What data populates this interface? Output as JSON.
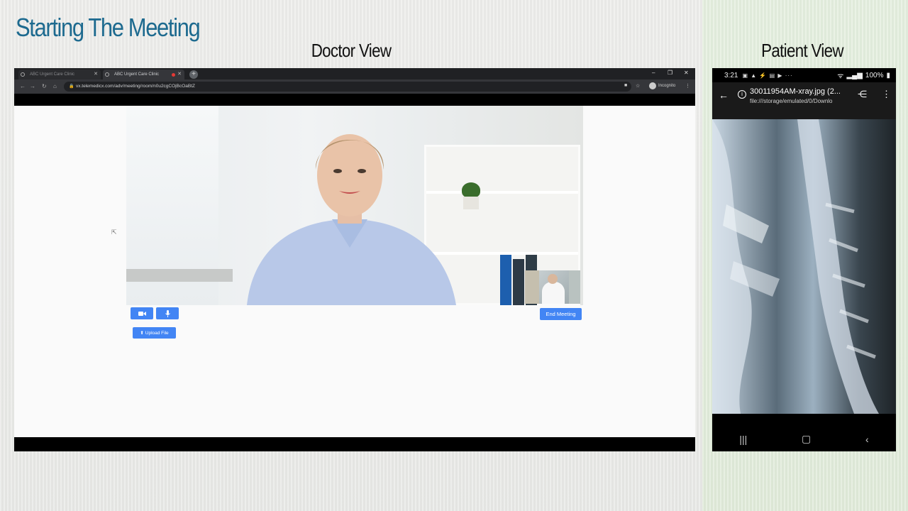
{
  "slide": {
    "title": "Starting The Meeting",
    "doctor_label": "Doctor View",
    "patient_label": "Patient View"
  },
  "browser": {
    "tabs": [
      {
        "label": "ABC Urgent Care Clinic",
        "active": false
      },
      {
        "label": "ABC Urgent Care Clinic",
        "active": true
      }
    ],
    "url": "vx.telemedicx.com/adv/meeting/room/n0u2cgCOjBcOaBtZ",
    "incognito_label": "Incognito",
    "icons": [
      "back-icon",
      "forward-icon",
      "reload-icon",
      "home-icon",
      "lock-icon",
      "camera-icon",
      "star-icon",
      "menu-icon"
    ]
  },
  "meeting": {
    "end_meeting_label": "End Meeting",
    "upload_label": "Upload File",
    "camera_icon": "video-camera-icon",
    "mic_icon": "microphone-icon"
  },
  "phone": {
    "status": {
      "time": "3:21",
      "battery": "100%"
    },
    "file_name": "30011954AM-xray.jpg (2...",
    "file_path": "file:///storage/emulated/0/Downlo",
    "nav": [
      "recent-apps-icon",
      "home-icon",
      "back-icon"
    ]
  },
  "colors": {
    "title_blue": "#1d6a8f",
    "button_blue": "#4285f4"
  }
}
